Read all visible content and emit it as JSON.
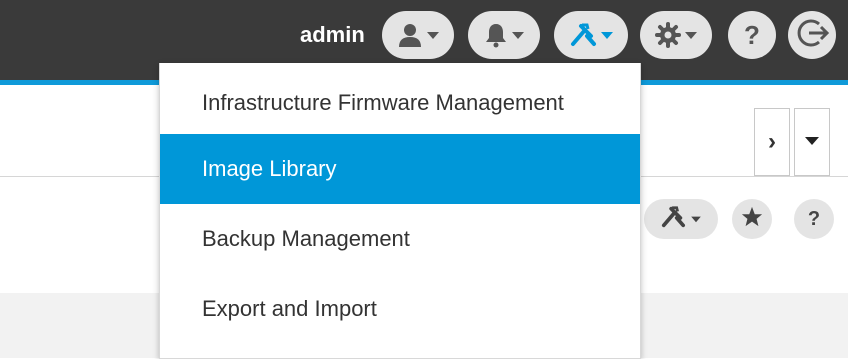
{
  "header": {
    "username": "admin",
    "help_label": "?",
    "icons": {
      "user": "user-icon",
      "notifications": "bell-icon",
      "tools": "tools-icon",
      "settings": "gear-icon",
      "help": "help-icon",
      "logout": "logout-icon"
    },
    "colors": {
      "bar": "#3a3a3a",
      "accent": "#0097d8"
    }
  },
  "tools_menu": {
    "items": [
      {
        "label": "Infrastructure Firmware Management",
        "active": false
      },
      {
        "label": "Image Library",
        "active": true
      },
      {
        "label": "Backup Management",
        "active": false
      },
      {
        "label": "Export and Import",
        "active": false
      }
    ]
  },
  "content": {
    "nav_next_label": "›",
    "toolbar_help_label": "?",
    "icons": {
      "next": "chevron-right-icon",
      "dropdown": "caret-down-icon",
      "tools": "tools-icon",
      "favorite": "star-icon",
      "help": "help-icon"
    }
  }
}
